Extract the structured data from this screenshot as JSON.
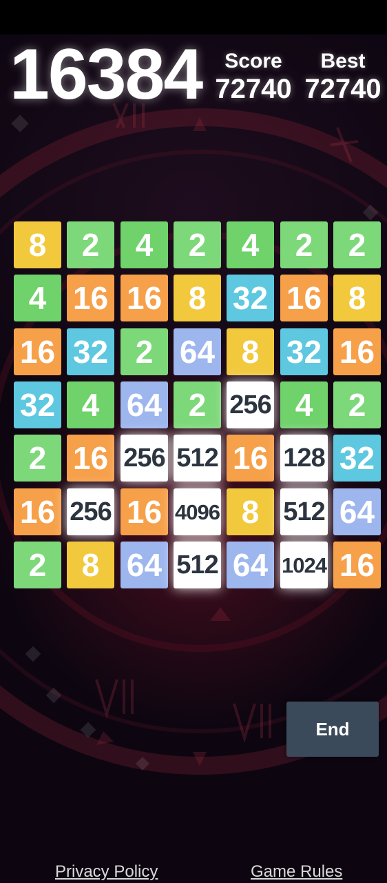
{
  "header": {
    "target_tile": "16384",
    "score_label": "Score",
    "score_value": "72740",
    "best_label": "Best",
    "best_value": "72740"
  },
  "board": {
    "rows": 7,
    "cols": 7,
    "tiles": [
      [
        "8",
        "2",
        "4",
        "2",
        "4",
        "2",
        "2"
      ],
      [
        "4",
        "16",
        "16",
        "8",
        "32",
        "16",
        "8"
      ],
      [
        "16",
        "32",
        "2",
        "64",
        "8",
        "32",
        "16"
      ],
      [
        "32",
        "4",
        "64",
        "2",
        "256",
        "4",
        "2"
      ],
      [
        "2",
        "16",
        "256",
        "512",
        "16",
        "128",
        "32"
      ],
      [
        "16",
        "256",
        "16",
        "4096",
        "8",
        "512",
        "64"
      ],
      [
        "2",
        "8",
        "64",
        "512",
        "64",
        "1024",
        "16"
      ]
    ]
  },
  "actions": {
    "end_label": "End"
  },
  "footer": {
    "privacy_label": "Privacy Policy",
    "rules_label": "Game Rules"
  },
  "colors": {
    "tile_2": "#7dd87a",
    "tile_4": "#6fd26b",
    "tile_8": "#f2c93d",
    "tile_16": "#f7a04a",
    "tile_32": "#5ec8e0",
    "tile_64": "#9db6ee",
    "tile_high": "#ffffff",
    "end_button": "#3b4a5a"
  }
}
